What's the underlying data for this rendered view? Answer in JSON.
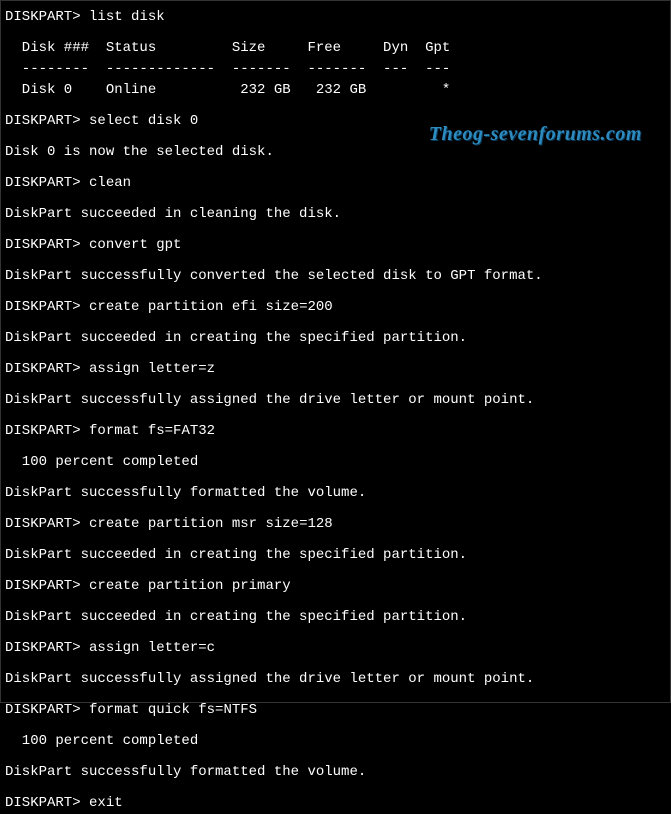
{
  "watermark": "Theog-sevenforums.com",
  "prompt": "DISKPART>",
  "commands": {
    "list_disk": "list disk",
    "select_disk": "select disk 0",
    "clean": "clean",
    "convert_gpt": "convert gpt",
    "create_efi": "create partition efi size=200",
    "assign_z": "assign letter=z",
    "format_fat32": "format fs=FAT32",
    "create_msr": "create partition msr size=128",
    "create_primary": "create partition primary",
    "assign_c": "assign letter=c",
    "format_ntfs": "format quick fs=NTFS",
    "exit": "exit"
  },
  "output": {
    "table_header": "  Disk ###  Status         Size     Free     Dyn  Gpt",
    "table_divider": "  --------  -------------  -------  -------  ---  ---",
    "table_row0": "  Disk 0    Online          232 GB   232 GB         *",
    "selected": "Disk 0 is now the selected disk.",
    "clean_ok": "DiskPart succeeded in cleaning the disk.",
    "convert_ok": "DiskPart successfully converted the selected disk to GPT format.",
    "create_ok": "DiskPart succeeded in creating the specified partition.",
    "assign_ok": "DiskPart successfully assigned the drive letter or mount point.",
    "percent": "  100 percent completed",
    "format_ok": "DiskPart successfully formatted the volume."
  }
}
